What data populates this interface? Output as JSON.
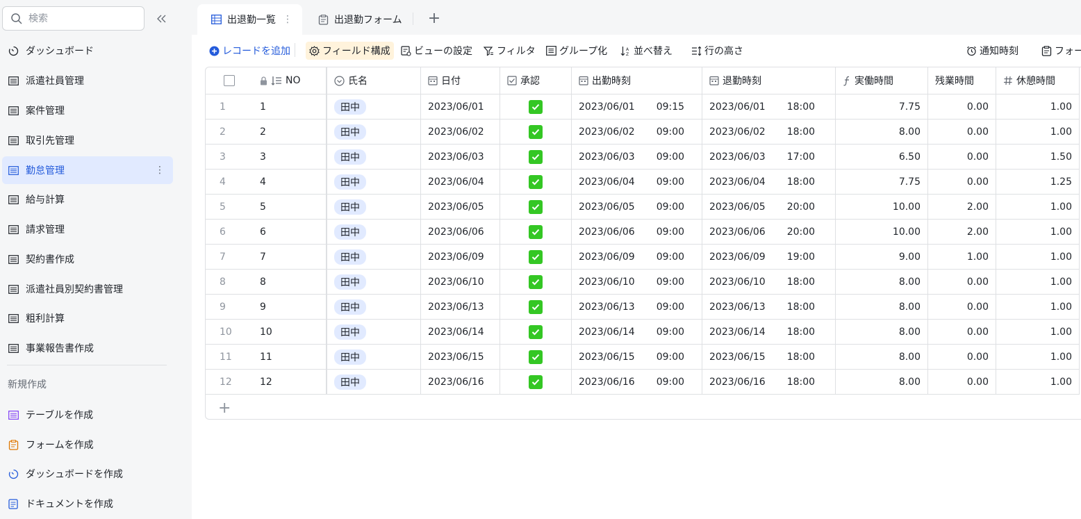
{
  "sidebar": {
    "search_placeholder": "検索",
    "items": [
      {
        "label": "ダッシュボード",
        "icon": "dashboard-icon"
      },
      {
        "label": "派遣社員管理",
        "icon": "table-icon"
      },
      {
        "label": "案件管理",
        "icon": "table-icon"
      },
      {
        "label": "取引先管理",
        "icon": "table-icon"
      },
      {
        "label": "勤怠管理",
        "icon": "table-icon",
        "active": true
      },
      {
        "label": "給与計算",
        "icon": "table-icon"
      },
      {
        "label": "請求管理",
        "icon": "table-icon"
      },
      {
        "label": "契約書作成",
        "icon": "table-icon"
      },
      {
        "label": "派遣社員別契約書管理",
        "icon": "table-icon"
      },
      {
        "label": "粗利計算",
        "icon": "table-icon"
      },
      {
        "label": "事業報告書作成",
        "icon": "table-icon"
      }
    ],
    "section_title": "新規作成",
    "create_items": [
      {
        "label": "テーブルを作成",
        "icon": "table-icon",
        "color": "#7f3bf5"
      },
      {
        "label": "フォームを作成",
        "icon": "form-icon",
        "color": "#de7802"
      },
      {
        "label": "ダッシュボードを作成",
        "icon": "dashboard-icon",
        "color": "#245bdb"
      },
      {
        "label": "ドキュメントを作成",
        "icon": "document-icon",
        "color": "#245bdb"
      }
    ]
  },
  "tabs": [
    {
      "label": "出退勤一覧",
      "active": true
    },
    {
      "label": "出退勤フォーム",
      "active": false
    }
  ],
  "toolbar": {
    "add_record": "レコードを追加",
    "field_config": "フィールド構成",
    "view_settings": "ビューの設定",
    "filter": "フィルタ",
    "group": "グループ化",
    "sort": "並べ替え",
    "row_height": "行の高さ",
    "notify_time": "通知時刻",
    "form": "フォーム"
  },
  "table": {
    "columns": [
      "NO",
      "氏名",
      "日付",
      "承認",
      "出勤時刻",
      "退勤時刻",
      "実働時間",
      "残業時間",
      "休憩時間"
    ],
    "rows": [
      {
        "idx": "1",
        "no": "1",
        "name": "田中",
        "date": "2023/06/01",
        "in_d": "2023/06/01",
        "in_t": "09:15",
        "out_d": "2023/06/01",
        "out_t": "18:00",
        "work": "7.75",
        "over": "0.00",
        "rest": "1.00"
      },
      {
        "idx": "2",
        "no": "2",
        "name": "田中",
        "date": "2023/06/02",
        "in_d": "2023/06/02",
        "in_t": "09:00",
        "out_d": "2023/06/02",
        "out_t": "18:00",
        "work": "8.00",
        "over": "0.00",
        "rest": "1.00"
      },
      {
        "idx": "3",
        "no": "3",
        "name": "田中",
        "date": "2023/06/03",
        "in_d": "2023/06/03",
        "in_t": "09:00",
        "out_d": "2023/06/03",
        "out_t": "17:00",
        "work": "6.50",
        "over": "0.00",
        "rest": "1.50"
      },
      {
        "idx": "4",
        "no": "4",
        "name": "田中",
        "date": "2023/06/04",
        "in_d": "2023/06/04",
        "in_t": "09:00",
        "out_d": "2023/06/04",
        "out_t": "18:00",
        "work": "7.75",
        "over": "0.00",
        "rest": "1.25"
      },
      {
        "idx": "5",
        "no": "5",
        "name": "田中",
        "date": "2023/06/05",
        "in_d": "2023/06/05",
        "in_t": "09:00",
        "out_d": "2023/06/05",
        "out_t": "20:00",
        "work": "10.00",
        "over": "2.00",
        "rest": "1.00"
      },
      {
        "idx": "6",
        "no": "6",
        "name": "田中",
        "date": "2023/06/06",
        "in_d": "2023/06/06",
        "in_t": "09:00",
        "out_d": "2023/06/06",
        "out_t": "20:00",
        "work": "10.00",
        "over": "2.00",
        "rest": "1.00"
      },
      {
        "idx": "7",
        "no": "7",
        "name": "田中",
        "date": "2023/06/09",
        "in_d": "2023/06/09",
        "in_t": "09:00",
        "out_d": "2023/06/09",
        "out_t": "19:00",
        "work": "9.00",
        "over": "1.00",
        "rest": "1.00"
      },
      {
        "idx": "8",
        "no": "8",
        "name": "田中",
        "date": "2023/06/10",
        "in_d": "2023/06/10",
        "in_t": "09:00",
        "out_d": "2023/06/10",
        "out_t": "18:00",
        "work": "8.00",
        "over": "0.00",
        "rest": "1.00"
      },
      {
        "idx": "9",
        "no": "9",
        "name": "田中",
        "date": "2023/06/13",
        "in_d": "2023/06/13",
        "in_t": "09:00",
        "out_d": "2023/06/13",
        "out_t": "18:00",
        "work": "8.00",
        "over": "0.00",
        "rest": "1.00"
      },
      {
        "idx": "10",
        "no": "10",
        "name": "田中",
        "date": "2023/06/14",
        "in_d": "2023/06/14",
        "in_t": "09:00",
        "out_d": "2023/06/14",
        "out_t": "18:00",
        "work": "8.00",
        "over": "0.00",
        "rest": "1.00"
      },
      {
        "idx": "11",
        "no": "11",
        "name": "田中",
        "date": "2023/06/15",
        "in_d": "2023/06/15",
        "in_t": "09:00",
        "out_d": "2023/06/15",
        "out_t": "18:00",
        "work": "8.00",
        "over": "0.00",
        "rest": "1.00"
      },
      {
        "idx": "12",
        "no": "12",
        "name": "田中",
        "date": "2023/06/16",
        "in_d": "2023/06/16",
        "in_t": "09:00",
        "out_d": "2023/06/16",
        "out_t": "18:00",
        "work": "8.00",
        "over": "0.00",
        "rest": "1.00"
      }
    ]
  },
  "colors": {
    "accent": "#245bdb",
    "active_bg": "#e1eaff",
    "check_green": "#34c724",
    "highlight": "#fff3dc"
  }
}
